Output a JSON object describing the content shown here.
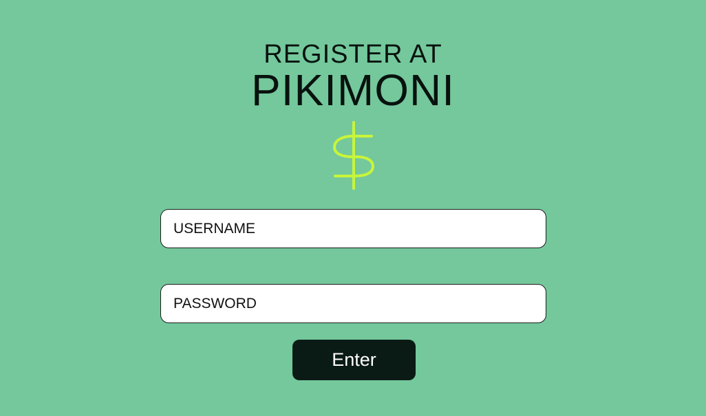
{
  "header": {
    "title_line1": "REGISTER AT",
    "title_line2": "PIKIMONI"
  },
  "logo": {
    "icon": "dollar-sign-icon",
    "color": "#C8F53A"
  },
  "form": {
    "username": {
      "value": "",
      "placeholder": "USERNAME"
    },
    "password": {
      "value": "",
      "placeholder": "PASSWORD"
    },
    "submit_label": "Enter"
  },
  "colors": {
    "background": "#74C89C",
    "button": "#0A1A15",
    "field": "#FFFFFF"
  }
}
